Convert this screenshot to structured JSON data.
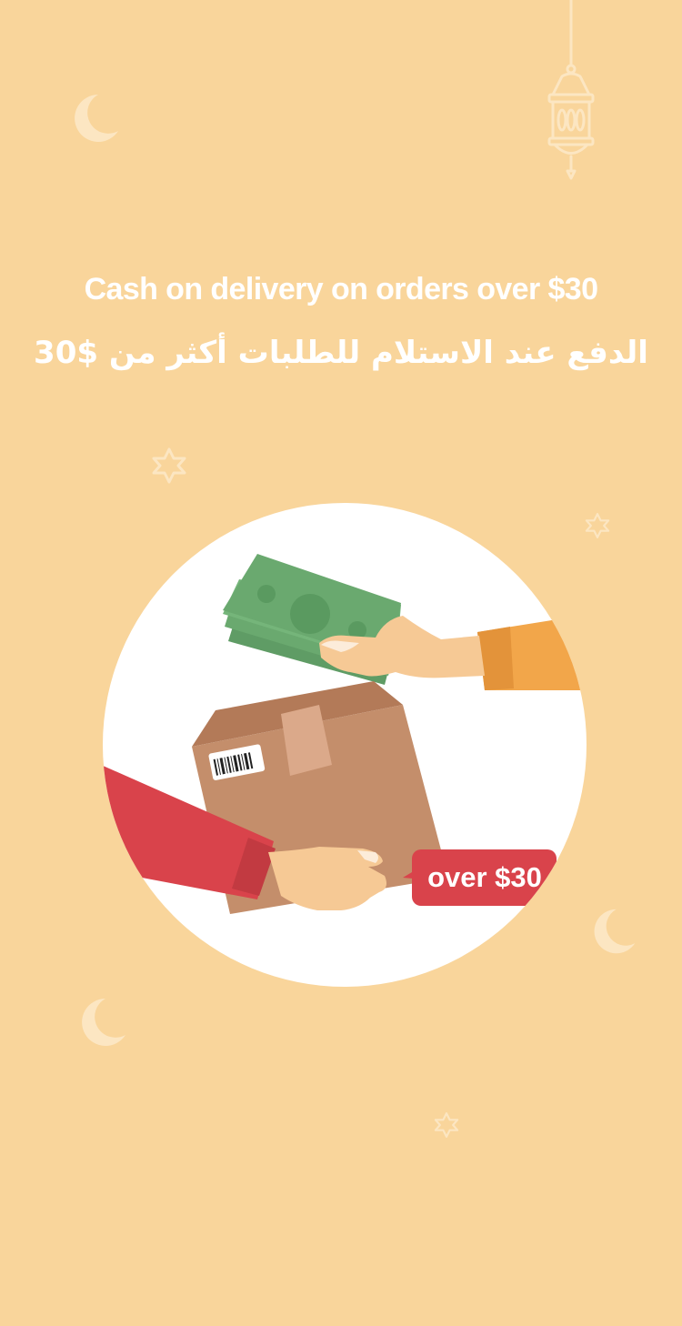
{
  "headline": {
    "english": "Cash on delivery on orders over $30",
    "arabic": "الدفع عند الاستلام للطلبات أكثر من $30"
  },
  "illustration": {
    "badge_text": "over $30",
    "colors": {
      "background": "#f9d59b",
      "circle": "#ffffff",
      "money": "#6aa96f",
      "box": "#c48e6b",
      "badge": "#d9434b",
      "sleeve_left": "#d9434b",
      "sleeve_right": "#f2a64a"
    }
  },
  "decorations": {
    "icons": [
      "crescent-moon-icon",
      "lantern-icon",
      "star-icon"
    ]
  }
}
